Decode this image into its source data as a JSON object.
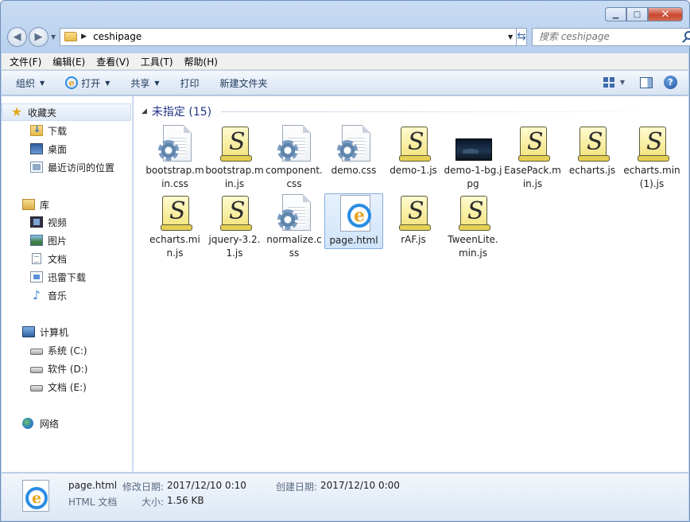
{
  "window": {
    "caption_buttons": {
      "minimize": "▁",
      "maximize": "□",
      "close": "✕"
    }
  },
  "address": {
    "path": "ceshipage",
    "search_placeholder": "搜索 ceshipage"
  },
  "menu": [
    "文件(F)",
    "编辑(E)",
    "查看(V)",
    "工具(T)",
    "帮助(H)"
  ],
  "toolbar": {
    "organize": "组织",
    "open": "打开",
    "share": "共享",
    "print": "打印",
    "new_folder": "新建文件夹"
  },
  "nav": {
    "favorites": "收藏夹",
    "favorites_items": [
      "下载",
      "桌面",
      "最近访问的位置"
    ],
    "libraries": "库",
    "library_items": [
      "视频",
      "图片",
      "文档",
      "迅雷下载",
      "音乐"
    ],
    "computer": "计算机",
    "drives": [
      "系统 (C:)",
      "软件 (D:)",
      "文档 (E:)"
    ],
    "network": "网络"
  },
  "content": {
    "group_title": "未指定 (15)",
    "files": [
      {
        "name": "bootstrap.min.css",
        "type": "css"
      },
      {
        "name": "bootstrap.min.js",
        "type": "js"
      },
      {
        "name": "component.css",
        "type": "css"
      },
      {
        "name": "demo.css",
        "type": "css"
      },
      {
        "name": "demo-1.js",
        "type": "js"
      },
      {
        "name": "demo-1-bg.jpg",
        "type": "jpg"
      },
      {
        "name": "EasePack.min.js",
        "type": "js"
      },
      {
        "name": "echarts.js",
        "type": "js"
      },
      {
        "name": "echarts.min (1).js",
        "type": "js"
      },
      {
        "name": "echarts.min.js",
        "type": "js"
      },
      {
        "name": "jquery-3.2.1.js",
        "type": "js"
      },
      {
        "name": "normalize.css",
        "type": "css"
      },
      {
        "name": "page.html",
        "type": "html",
        "selected": true
      },
      {
        "name": "rAF.js",
        "type": "js"
      },
      {
        "name": "TweenLite.min.js",
        "type": "js"
      }
    ]
  },
  "details": {
    "filename": "page.html",
    "filetype": "HTML 文档",
    "modified_label": "修改日期:",
    "modified": "2017/12/10 0:10",
    "created_label": "创建日期:",
    "created": "2017/12/10 0:00",
    "size_label": "大小:",
    "size": "1.56 KB"
  }
}
